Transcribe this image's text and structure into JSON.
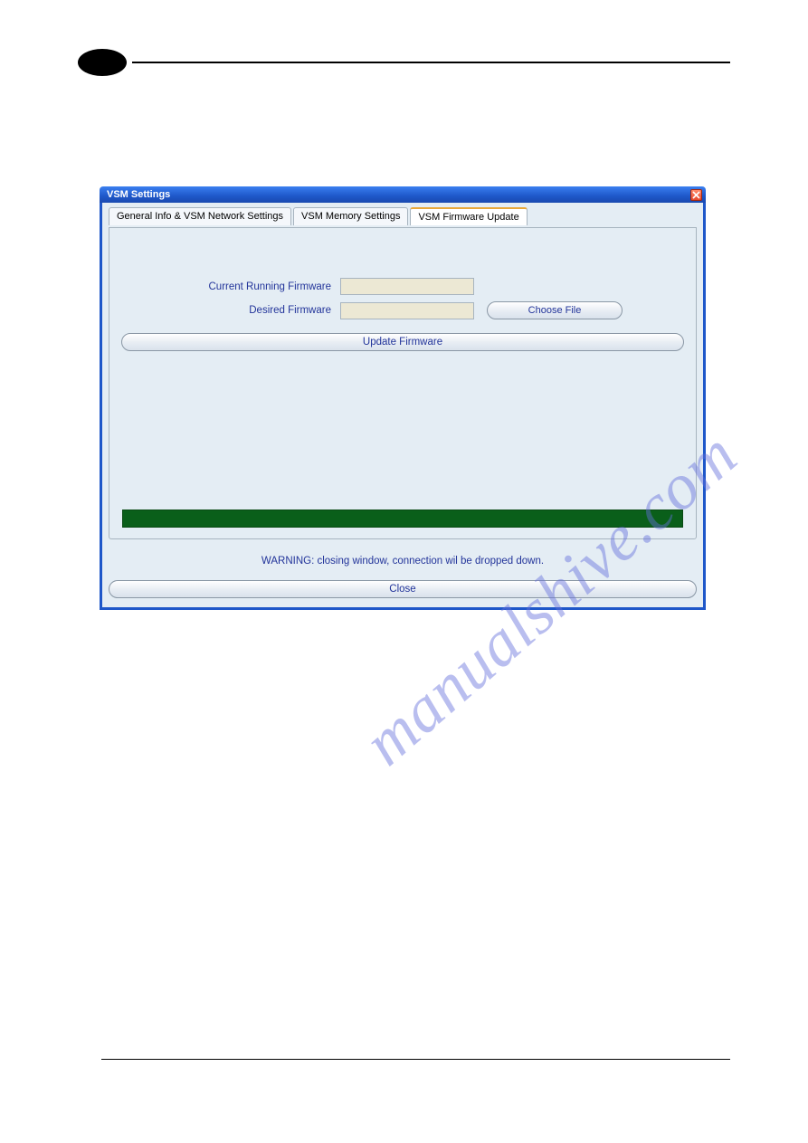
{
  "dialog": {
    "title": "VSM Settings",
    "tabs": [
      {
        "label": "General Info & VSM Network Settings"
      },
      {
        "label": "VSM Memory Settings"
      },
      {
        "label": "VSM Firmware Update"
      }
    ],
    "form": {
      "current_firmware_label": "Current Running Firmware",
      "current_firmware_value": "",
      "desired_firmware_label": "Desired Firmware",
      "desired_firmware_value": "",
      "choose_file_label": "Choose File",
      "update_label": "Update Firmware"
    },
    "warning": "WARNING: closing window, connection wil be dropped down.",
    "close_label": "Close"
  },
  "watermark": "manualshive.com"
}
